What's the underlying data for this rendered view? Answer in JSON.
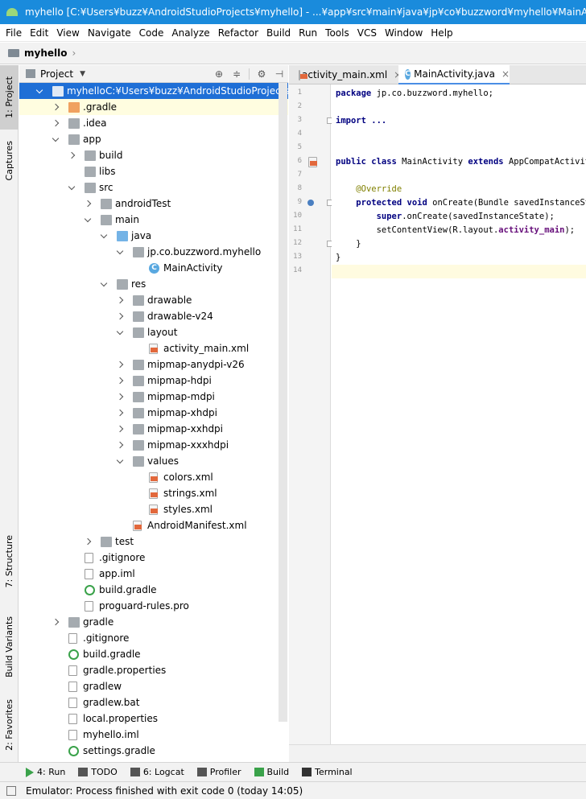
{
  "window": {
    "title": "myhello [C:¥Users¥buzz¥AndroidStudioProjects¥myhello] - ...¥app¥src¥main¥java¥jp¥co¥buzzword¥myhello¥MainActivity.java [app]"
  },
  "menu": [
    "File",
    "Edit",
    "View",
    "Navigate",
    "Code",
    "Analyze",
    "Refactor",
    "Build",
    "Run",
    "Tools",
    "VCS",
    "Window",
    "Help"
  ],
  "breadcrumb": {
    "project": "myhello"
  },
  "left_tabs": {
    "project": "1: Project",
    "captures": "Captures",
    "structure": "7: Structure",
    "build_variants": "Build Variants",
    "favorites": "2: Favorites"
  },
  "project_panel": {
    "view": "Project",
    "icons": {
      "locate": "target-icon",
      "collapse": "collapse-icon",
      "settings": "gear-icon",
      "hide": "hide-icon"
    }
  },
  "tree": [
    {
      "label": "myhello",
      "path": "C:¥Users¥buzz¥AndroidStudioProjects¥myhello",
      "depth": 0,
      "state": "e",
      "icon": "module",
      "selected": true
    },
    {
      "label": ".gradle",
      "depth": 1,
      "state": "c",
      "icon": "folder-orange"
    },
    {
      "label": ".idea",
      "depth": 1,
      "state": "c",
      "icon": "folder"
    },
    {
      "label": "app",
      "depth": 1,
      "state": "e",
      "icon": "folder-module"
    },
    {
      "label": "build",
      "depth": 2,
      "state": "c",
      "icon": "folder"
    },
    {
      "label": "libs",
      "depth": 2,
      "state": "",
      "icon": "folder"
    },
    {
      "label": "src",
      "depth": 2,
      "state": "e",
      "icon": "folder"
    },
    {
      "label": "androidTest",
      "depth": 3,
      "state": "c",
      "icon": "folder"
    },
    {
      "label": "main",
      "depth": 3,
      "state": "e",
      "icon": "folder"
    },
    {
      "label": "java",
      "depth": 4,
      "state": "e",
      "icon": "folder-blue"
    },
    {
      "label": "jp.co.buzzword.myhello",
      "depth": 5,
      "state": "e",
      "icon": "package"
    },
    {
      "label": "MainActivity",
      "depth": 6,
      "state": "",
      "icon": "class"
    },
    {
      "label": "res",
      "depth": 4,
      "state": "e",
      "icon": "folder-res"
    },
    {
      "label": "drawable",
      "depth": 5,
      "state": "c",
      "icon": "folder"
    },
    {
      "label": "drawable-v24",
      "depth": 5,
      "state": "c",
      "icon": "folder"
    },
    {
      "label": "layout",
      "depth": 5,
      "state": "e",
      "icon": "folder"
    },
    {
      "label": "activity_main.xml",
      "depth": 6,
      "state": "",
      "icon": "xml"
    },
    {
      "label": "mipmap-anydpi-v26",
      "depth": 5,
      "state": "c",
      "icon": "folder"
    },
    {
      "label": "mipmap-hdpi",
      "depth": 5,
      "state": "c",
      "icon": "folder"
    },
    {
      "label": "mipmap-mdpi",
      "depth": 5,
      "state": "c",
      "icon": "folder"
    },
    {
      "label": "mipmap-xhdpi",
      "depth": 5,
      "state": "c",
      "icon": "folder"
    },
    {
      "label": "mipmap-xxhdpi",
      "depth": 5,
      "state": "c",
      "icon": "folder"
    },
    {
      "label": "mipmap-xxxhdpi",
      "depth": 5,
      "state": "c",
      "icon": "folder"
    },
    {
      "label": "values",
      "depth": 5,
      "state": "e",
      "icon": "folder"
    },
    {
      "label": "colors.xml",
      "depth": 6,
      "state": "",
      "icon": "xml"
    },
    {
      "label": "strings.xml",
      "depth": 6,
      "state": "",
      "icon": "xml"
    },
    {
      "label": "styles.xml",
      "depth": 6,
      "state": "",
      "icon": "xml"
    },
    {
      "label": "AndroidManifest.xml",
      "depth": 5,
      "state": "",
      "icon": "manifest"
    },
    {
      "label": "test",
      "depth": 3,
      "state": "c",
      "icon": "folder"
    },
    {
      "label": ".gitignore",
      "depth": 2,
      "state": "",
      "icon": "doc"
    },
    {
      "label": "app.iml",
      "depth": 2,
      "state": "",
      "icon": "doc"
    },
    {
      "label": "build.gradle",
      "depth": 2,
      "state": "",
      "icon": "gradle"
    },
    {
      "label": "proguard-rules.pro",
      "depth": 2,
      "state": "",
      "icon": "doc"
    },
    {
      "label": "gradle",
      "depth": 1,
      "state": "c",
      "icon": "folder"
    },
    {
      "label": ".gitignore",
      "depth": 1,
      "state": "",
      "icon": "doc"
    },
    {
      "label": "build.gradle",
      "depth": 1,
      "state": "",
      "icon": "gradle"
    },
    {
      "label": "gradle.properties",
      "depth": 1,
      "state": "",
      "icon": "doc"
    },
    {
      "label": "gradlew",
      "depth": 1,
      "state": "",
      "icon": "doc"
    },
    {
      "label": "gradlew.bat",
      "depth": 1,
      "state": "",
      "icon": "doc"
    },
    {
      "label": "local.properties",
      "depth": 1,
      "state": "",
      "icon": "doc"
    },
    {
      "label": "myhello.iml",
      "depth": 1,
      "state": "",
      "icon": "doc"
    },
    {
      "label": "settings.gradle",
      "depth": 1,
      "state": "",
      "icon": "gradle"
    }
  ],
  "editor_tabs": [
    {
      "label": "activity_main.xml",
      "icon": "xml",
      "active": false
    },
    {
      "label": "MainActivity.java",
      "icon": "class",
      "active": true
    }
  ],
  "code": [
    [
      [
        "kw",
        "package"
      ],
      [
        "t",
        " jp.co.buzzword.myhello;"
      ]
    ],
    [],
    [
      [
        "kw",
        "import"
      ],
      [
        "t",
        " "
      ],
      [
        "kw",
        "..."
      ]
    ],
    [],
    [],
    [
      [
        "kw",
        "public class"
      ],
      [
        "t",
        " MainActivity "
      ],
      [
        "kw",
        "extends"
      ],
      [
        "t",
        " AppCompatActivity {"
      ]
    ],
    [],
    [
      [
        "t",
        "    "
      ],
      [
        "an",
        "@Override"
      ]
    ],
    [
      [
        "t",
        "    "
      ],
      [
        "kw",
        "protected void"
      ],
      [
        "t",
        " onCreate(Bundle savedInstanceState) {"
      ]
    ],
    [
      [
        "t",
        "        "
      ],
      [
        "kw",
        "super"
      ],
      [
        "t",
        ".onCreate(savedInstanceState);"
      ]
    ],
    [
      [
        "t",
        "        setContentView(R.layout."
      ],
      [
        "fld",
        "activity_main"
      ],
      [
        "t",
        ");"
      ]
    ],
    [
      [
        "t",
        "    }"
      ]
    ],
    [
      [
        "t",
        "}"
      ]
    ],
    []
  ],
  "bottom_tools": [
    {
      "label": "4: Run",
      "icon": "run-icon",
      "color": "#3aa24a"
    },
    {
      "label": "TODO",
      "icon": "todo-icon",
      "color": "#555555"
    },
    {
      "label": "6: Logcat",
      "icon": "logcat-icon",
      "color": "#555555"
    },
    {
      "label": "Profiler",
      "icon": "profiler-icon",
      "color": "#555555"
    },
    {
      "label": "Build",
      "icon": "build-icon",
      "color": "#3aa24a"
    },
    {
      "label": "Terminal",
      "icon": "terminal-icon",
      "color": "#333333"
    }
  ],
  "status": {
    "text": "Emulator: Process finished with exit code 0 (today 14:05)"
  }
}
